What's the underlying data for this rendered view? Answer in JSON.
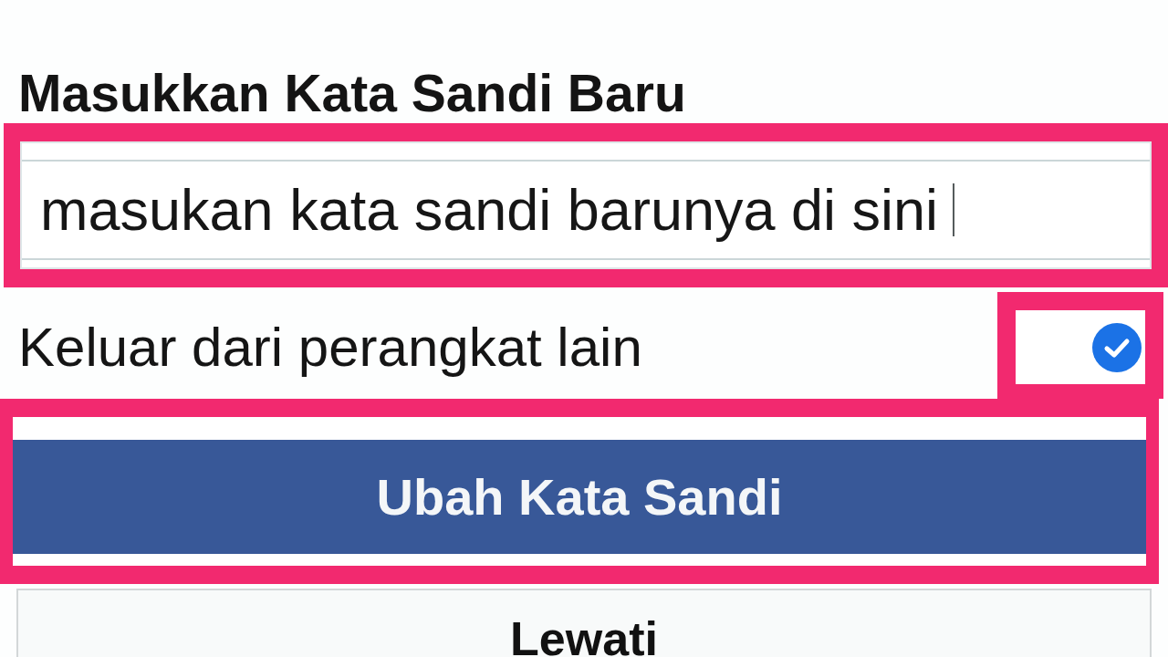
{
  "new_password": {
    "label": "Masukkan Kata Sandi Baru",
    "value": "masukan kata sandi barunya di sini",
    "highlighted": true
  },
  "logout_other_devices": {
    "label": "Keluar dari perangkat lain",
    "checked": true,
    "highlighted": true
  },
  "buttons": [
    {
      "label": "Ubah Kata Sandi",
      "kind": "primary",
      "highlighted": true
    },
    {
      "label": "Lewati",
      "kind": "secondary",
      "highlighted": false
    }
  ]
}
